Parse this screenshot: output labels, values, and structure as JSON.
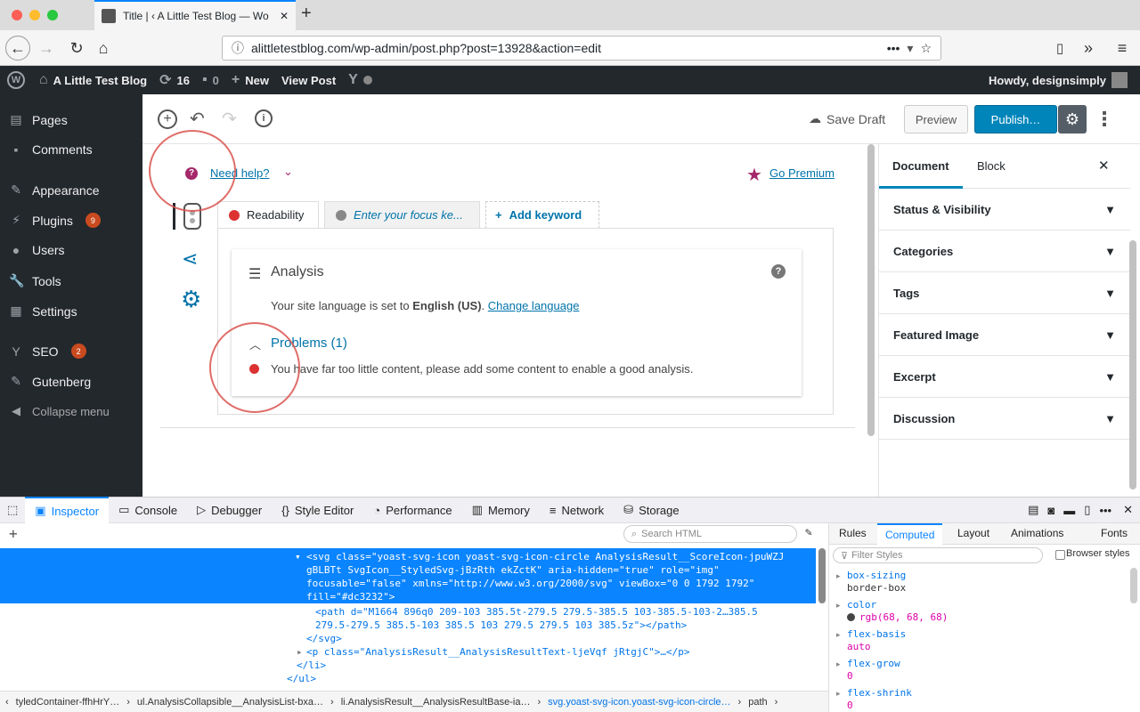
{
  "browser": {
    "tab_title": "Title | ‹ A Little Test Blog — Wo",
    "url": "alittletestblog.com/wp-admin/post.php?post=13928&action=edit"
  },
  "adminbar": {
    "site_name": "A Little Test Blog",
    "updates_count": "16",
    "comments_count": "0",
    "new_label": "New",
    "view_post_label": "View Post",
    "howdy": "Howdy, designsimply"
  },
  "sidebar": {
    "items": [
      {
        "label": "Pages",
        "icon": "pages-icon"
      },
      {
        "label": "Comments",
        "icon": "comments-icon"
      },
      {
        "label": "Appearance",
        "icon": "appearance-icon"
      },
      {
        "label": "Plugins",
        "icon": "plugins-icon",
        "badge": "9"
      },
      {
        "label": "Users",
        "icon": "users-icon"
      },
      {
        "label": "Tools",
        "icon": "tools-icon"
      },
      {
        "label": "Settings",
        "icon": "settings-icon"
      },
      {
        "label": "SEO",
        "icon": "seo-icon",
        "badge": "2"
      },
      {
        "label": "Gutenberg",
        "icon": "gutenberg-icon"
      },
      {
        "label": "Collapse menu",
        "icon": "collapse-icon"
      }
    ]
  },
  "toolbar": {
    "save_draft": "Save Draft",
    "preview": "Preview",
    "publish": "Publish…"
  },
  "yoast": {
    "need_help": "Need help?",
    "go_premium": "Go Premium",
    "tab_readability": "Readability",
    "focus_placeholder": "Enter your focus ke...",
    "add_keyword": "Add keyword",
    "analysis_title": "Analysis",
    "language_prefix": "Your site language is set to ",
    "language_value": "English (US)",
    "language_suffix": ".",
    "change_language": "Change language",
    "problems_title": "Problems (1)",
    "problem_text": "You have far too little content, please add some content to enable a good analysis."
  },
  "docpanel": {
    "tab_document": "Document",
    "tab_block": "Block",
    "sections": [
      "Status & Visibility",
      "Categories",
      "Tags",
      "Featured Image",
      "Excerpt",
      "Discussion"
    ]
  },
  "devtools": {
    "tabs": [
      "Inspector",
      "Console",
      "Debugger",
      "Style Editor",
      "Performance",
      "Memory",
      "Network",
      "Storage"
    ],
    "search_placeholder": "Search HTML",
    "markup_lines": [
      "<svg class=\"yoast-svg-icon yoast-svg-icon-circle AnalysisResult__ScoreIcon-jpuWZJ",
      "gBLBTt SvgIcon__StyledSvg-jBzRth ekZctK\" aria-hidden=\"true\" role=\"img\"",
      "focusable=\"false\" xmlns=\"http://www.w3.org/2000/svg\" viewBox=\"0 0 1792 1792\"",
      "fill=\"#dc3232\">",
      "<path d=\"M1664 896q0 209-103 385.5t-279.5 279.5-385.5 103-385.5-103-2…385.5",
      "279.5-279.5 385.5-103 385.5 103 279.5 279.5 103 385.5z\"></path>",
      "</svg>",
      "<p class=\"AnalysisResult__AnalysisResultText-ljeVqf jRtgjC\">…</p>",
      "</li>",
      "</ul>"
    ],
    "breadcrumbs": [
      "tyledContainer-ffhHrY…",
      "ul.AnalysisCollapsible__AnalysisList-bxa…",
      "li.AnalysisResult__AnalysisResultBase-ia…",
      "svg.yoast-svg-icon.yoast-svg-icon-circle…",
      "path"
    ],
    "side_tabs": [
      "Rules",
      "Computed",
      "Layout",
      "Animations",
      "Fonts"
    ],
    "filter_placeholder": "Filter Styles",
    "browser_styles": "Browser styles",
    "computed": [
      {
        "prop": "box-sizing",
        "value": "border-box"
      },
      {
        "prop": "color",
        "value": "rgb(68, 68, 68)"
      },
      {
        "prop": "flex-basis",
        "value": "auto"
      },
      {
        "prop": "flex-grow",
        "value": "0"
      },
      {
        "prop": "flex-shrink",
        "value": "0"
      }
    ]
  },
  "colors": {
    "wp_dark": "#23282d",
    "wp_blue": "#0085ba",
    "yoast_red": "#dc3232",
    "yoast_purple": "#a4286a",
    "devtools_blue": "#0a84ff"
  }
}
